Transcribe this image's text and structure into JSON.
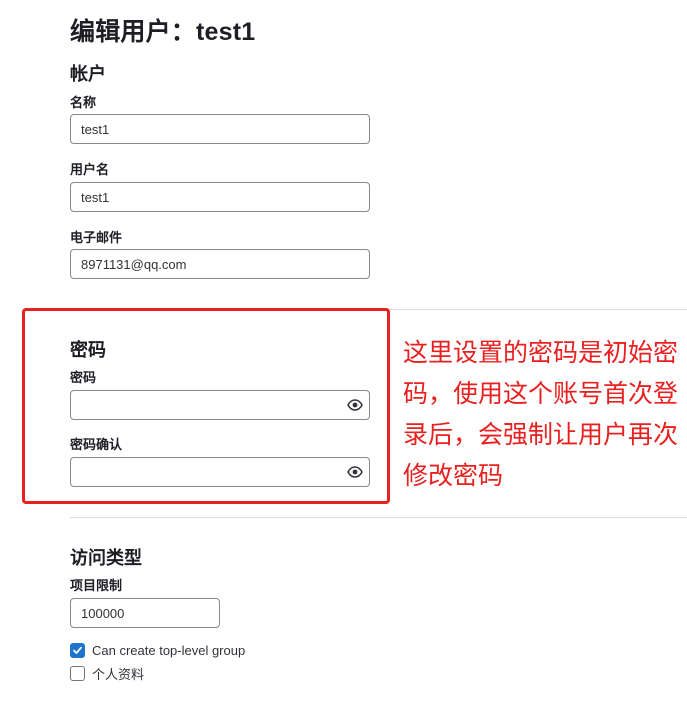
{
  "page": {
    "title": "编辑用户：test1"
  },
  "account": {
    "heading": "帐户",
    "name_label": "名称",
    "name_value": "test1",
    "username_label": "用户名",
    "username_value": "test1",
    "email_label": "电子邮件",
    "email_value": "8971131@qq.com"
  },
  "password": {
    "heading": "密码",
    "password_label": "密码",
    "password_value": "",
    "confirm_label": "密码确认",
    "confirm_value": ""
  },
  "annotation": {
    "text": "这里设置的密码是初始密码，使用这个账号首次登录后，会强制让用户再次修改密码",
    "color": "#e8201f"
  },
  "access": {
    "heading": "访问类型",
    "project_limit_label": "项目限制",
    "project_limit_value": "100000",
    "can_create_group_label": "Can create top-level group",
    "can_create_group_checked": true,
    "private_profile_label": "个人资料",
    "private_profile_checked": false
  },
  "colors": {
    "accent": "#1f75cb",
    "annotation": "#e8201f"
  }
}
